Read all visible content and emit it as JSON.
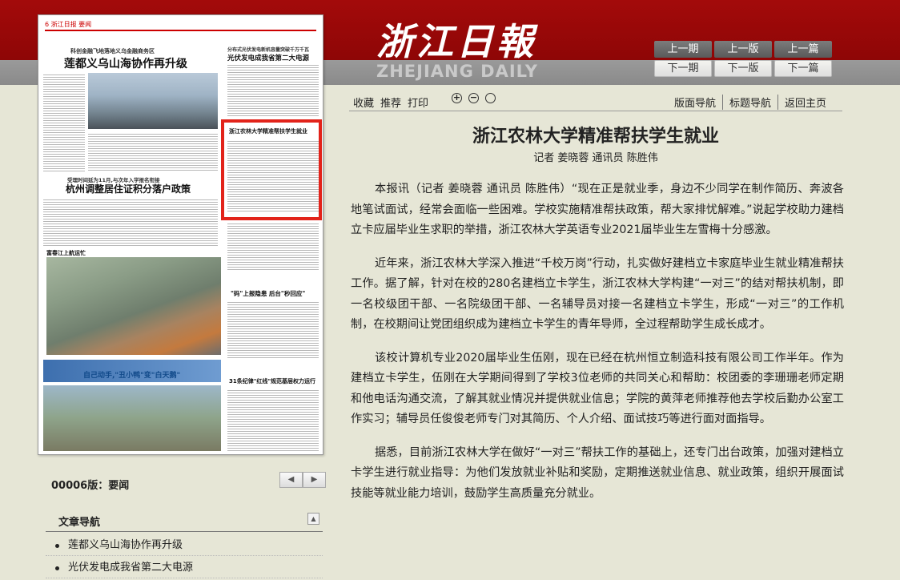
{
  "brand": {
    "cn": "浙江日報",
    "en": "ZHEJIANG DAILY"
  },
  "pager": {
    "prev_issue": "上一期",
    "prev_page": "上一版",
    "prev_article": "上一篇",
    "next_issue": "下一期",
    "next_page": "下一版",
    "next_article": "下一篇"
  },
  "newspaper": {
    "page_label": "6 浙江日报 要闻",
    "headlines": {
      "h1_kicker": "科创金融飞地落地义乌金融商务区",
      "h1": "莲都义乌山海协作再升级",
      "h2_kicker": "分布式光伏发电新机容量突破千万千瓦",
      "h2": "光伏发电成我省第二大电源",
      "h3": "浙江农林大学精准帮扶学生就业",
      "h4_kicker": "受理时间延为11月,与次年入学报名衔接",
      "h4": "杭州调整居住证积分落户政策",
      "h5": "富春江上航运忙",
      "h6": "\"码\"上报隐患 后台\"秒回应\"",
      "h7": "自己动手,\"丑小鸭\"变\"白天鹅\"",
      "h8": "31条纪律\"红线\"规范基层权力运行"
    }
  },
  "version": {
    "label": "00006版：要闻",
    "prev": "◀",
    "next": "▶"
  },
  "article_nav": {
    "title": "文章导航",
    "collapse": "▲",
    "items": [
      "莲都义乌山海协作再升级",
      "光伏发电成我省第二大电源"
    ]
  },
  "toolbar": {
    "collect": "收藏",
    "recommend": "推荐",
    "print": "打印",
    "zoom_in": "+",
    "zoom_out": "−",
    "zoom_reset": "○",
    "page_nav": "版面导航",
    "title_nav": "标题导航",
    "home": "返回主页"
  },
  "article": {
    "title": "浙江农林大学精准帮扶学生就业",
    "byline": "记者 姜晓蓉 通讯员 陈胜伟",
    "paragraphs": [
      "本报讯（记者 姜晓蓉 通讯员 陈胜伟）“现在正是就业季，身边不少同学在制作简历、奔波各地笔试面试，经常会面临一些困难。学校实施精准帮扶政策，帮大家排忧解难。”说起学校助力建档立卡应届毕业生求职的举措，浙江农林大学英语专业2021届毕业生左雪梅十分感激。",
      "近年来，浙江农林大学深入推进“千校万岗”行动，扎实做好建档立卡家庭毕业生就业精准帮扶工作。据了解，针对在校的280名建档立卡学生，浙江农林大学构建“一对三”的结对帮扶机制，即一名校级团干部、一名院级团干部、一名辅导员对接一名建档立卡学生，形成“一对三”的工作机制，在校期间让党团组织成为建档立卡学生的青年导师，全过程帮助学生成长成才。",
      "该校计算机专业2020届毕业生伍刚，现在已经在杭州恒立制造科技有限公司工作半年。作为建档立卡学生，伍刚在大学期间得到了学校3位老师的共同关心和帮助：校团委的李珊珊老师定期和他电话沟通交流，了解其就业情况并提供就业信息；学院的黄萍老师推荐他去学校后勤办公室工作实习；辅导员任俊俊老师专门对其简历、个人介绍、面试技巧等进行面对面指导。",
      "据悉，目前浙江农林大学在做好“一对三”帮扶工作的基础上，还专门出台政策，加强对建档立卡学生进行就业指导：为他们发放就业补贴和奖励，定期推送就业信息、就业政策，组织开展面试技能等就业能力培训，鼓励学生高质量充分就业。"
    ]
  }
}
